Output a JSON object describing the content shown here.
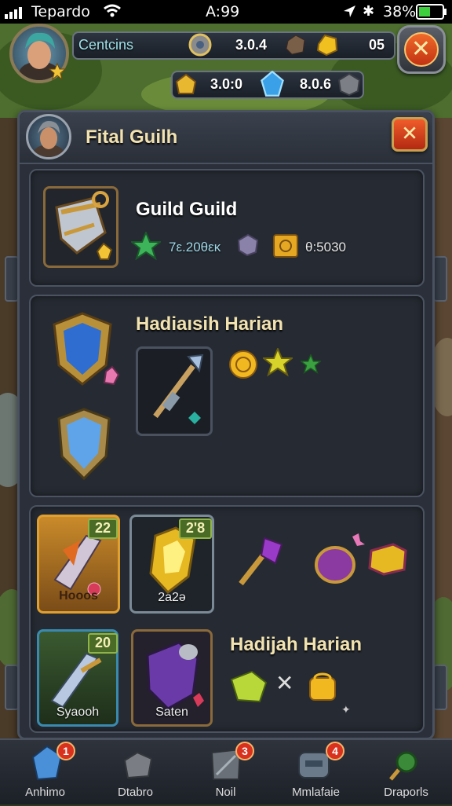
{
  "status_bar": {
    "carrier": "Tepardo",
    "time": "A:99",
    "battery": "38%"
  },
  "top_bar": {
    "name_field": "Centcins",
    "resource_1": "3.0.4",
    "resource_2": "05",
    "resource_3": "3.0:0",
    "resource_4": "8.0.6"
  },
  "panel": {
    "title": "Fital Guilh",
    "guild_card": {
      "title": "Guild Guild",
      "stat_1": "7ε.20θεκ",
      "stat_2": "θ:5030"
    },
    "daily_card": {
      "title": "Hadiaısih Harian"
    },
    "items": [
      {
        "level": "22",
        "label": "Hooos"
      },
      {
        "level": "2'8",
        "label": "2a2ə"
      },
      {
        "level": "20",
        "label": "Syaooh"
      },
      {
        "level": "",
        "label": "Saten"
      }
    ],
    "reward_title": "Hadijah Harian"
  },
  "bottom_nav": [
    {
      "label": "Anhimo",
      "badge": "1"
    },
    {
      "label": "Dtabro",
      "badge": ""
    },
    {
      "label": "Noil",
      "badge": "3"
    },
    {
      "label": "Mmlafaie",
      "badge": "4"
    },
    {
      "label": "Draporls",
      "badge": ""
    }
  ],
  "colors": {
    "accent_gold": "#f1e2b0",
    "close_red": "#e0441c",
    "panel_bg": "#2a2f3a",
    "level_green": "#4a6b25"
  }
}
